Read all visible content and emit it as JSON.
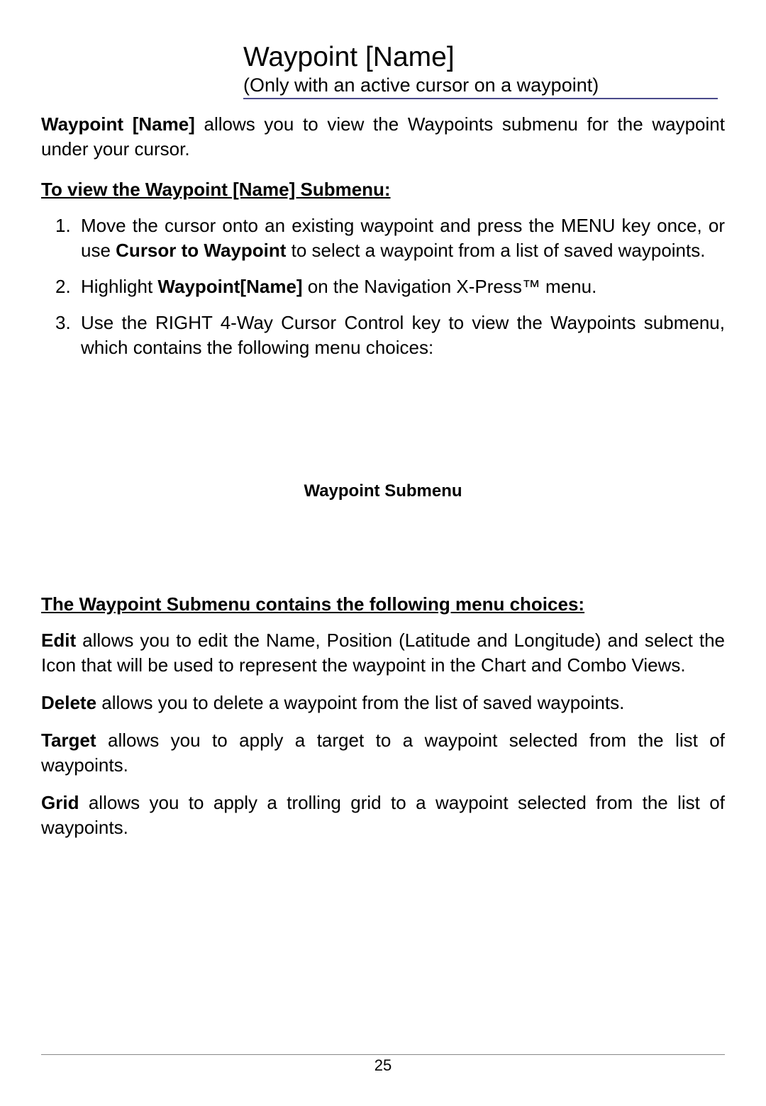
{
  "header": {
    "title": "Waypoint [Name]",
    "subtitle": "(Only with an active cursor on a waypoint)"
  },
  "intro": {
    "bold": "Waypoint [Name]",
    "rest": " allows you to view the Waypoints submenu for the waypoint under your cursor."
  },
  "section1_heading": "To view the Waypoint [Name] Submenu:",
  "steps": {
    "s1_a": "Move the cursor onto an existing waypoint and press the MENU key once, or use ",
    "s1_bold": "Cursor to Waypoint",
    "s1_b": " to select a waypoint from a list of saved waypoints.",
    "s2_a": "Highlight ",
    "s2_bold": "Waypoint[Name]",
    "s2_b": " on the Navigation X-Press™ menu.",
    "s3": "Use the RIGHT 4-Way Cursor Control key to view the Waypoints submenu, which contains the following menu choices:"
  },
  "caption": "Waypoint Submenu",
  "section2_heading": "The Waypoint Submenu contains the following menu choices:",
  "choices": {
    "edit_bold": "Edit",
    "edit_rest": " allows you to edit the Name, Position (Latitude and Longitude) and select the Icon that will be used to represent the waypoint in the Chart and Combo Views.",
    "delete_bold": "Delete",
    "delete_rest": " allows you to delete a waypoint from the list of saved waypoints.",
    "target_bold": "Target",
    "target_rest": " allows you to apply a target to a waypoint selected from the list of waypoints.",
    "grid_bold": "Grid",
    "grid_rest": " allows you to apply a trolling grid to a waypoint selected from the list of waypoints."
  },
  "page_number": "25"
}
